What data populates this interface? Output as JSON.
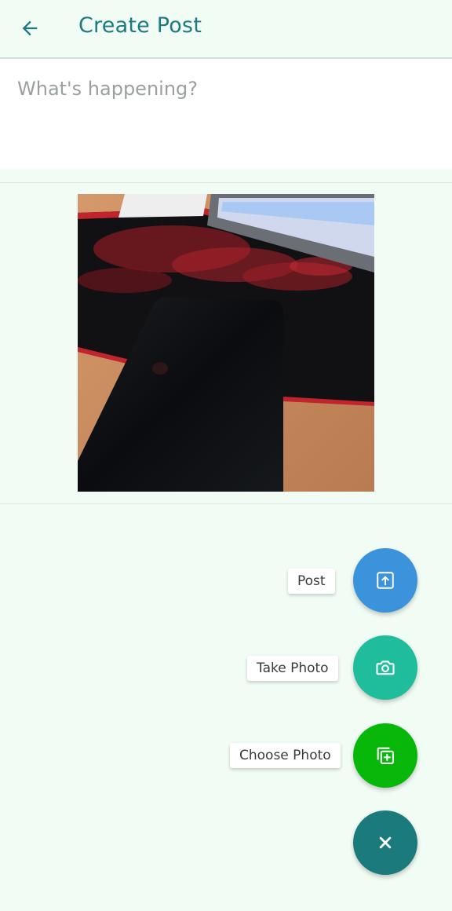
{
  "header": {
    "title": "Create Post",
    "back_icon": "arrow-left-icon"
  },
  "composer": {
    "placeholder": "What's happening?",
    "value": ""
  },
  "fab_menu": {
    "actions": [
      {
        "label": "Post",
        "icon": "upload-icon",
        "color": "#3b93dc"
      },
      {
        "label": "Take Photo",
        "icon": "camera-icon",
        "color": "#1fbd9b"
      },
      {
        "label": "Choose Photo",
        "icon": "add-photo-icon",
        "color": "#07b80b"
      }
    ],
    "close": {
      "icon": "close-icon",
      "color": "#1b7b7c"
    }
  },
  "colors": {
    "accent": "#1d7b80",
    "background": "#f1fcf4"
  }
}
